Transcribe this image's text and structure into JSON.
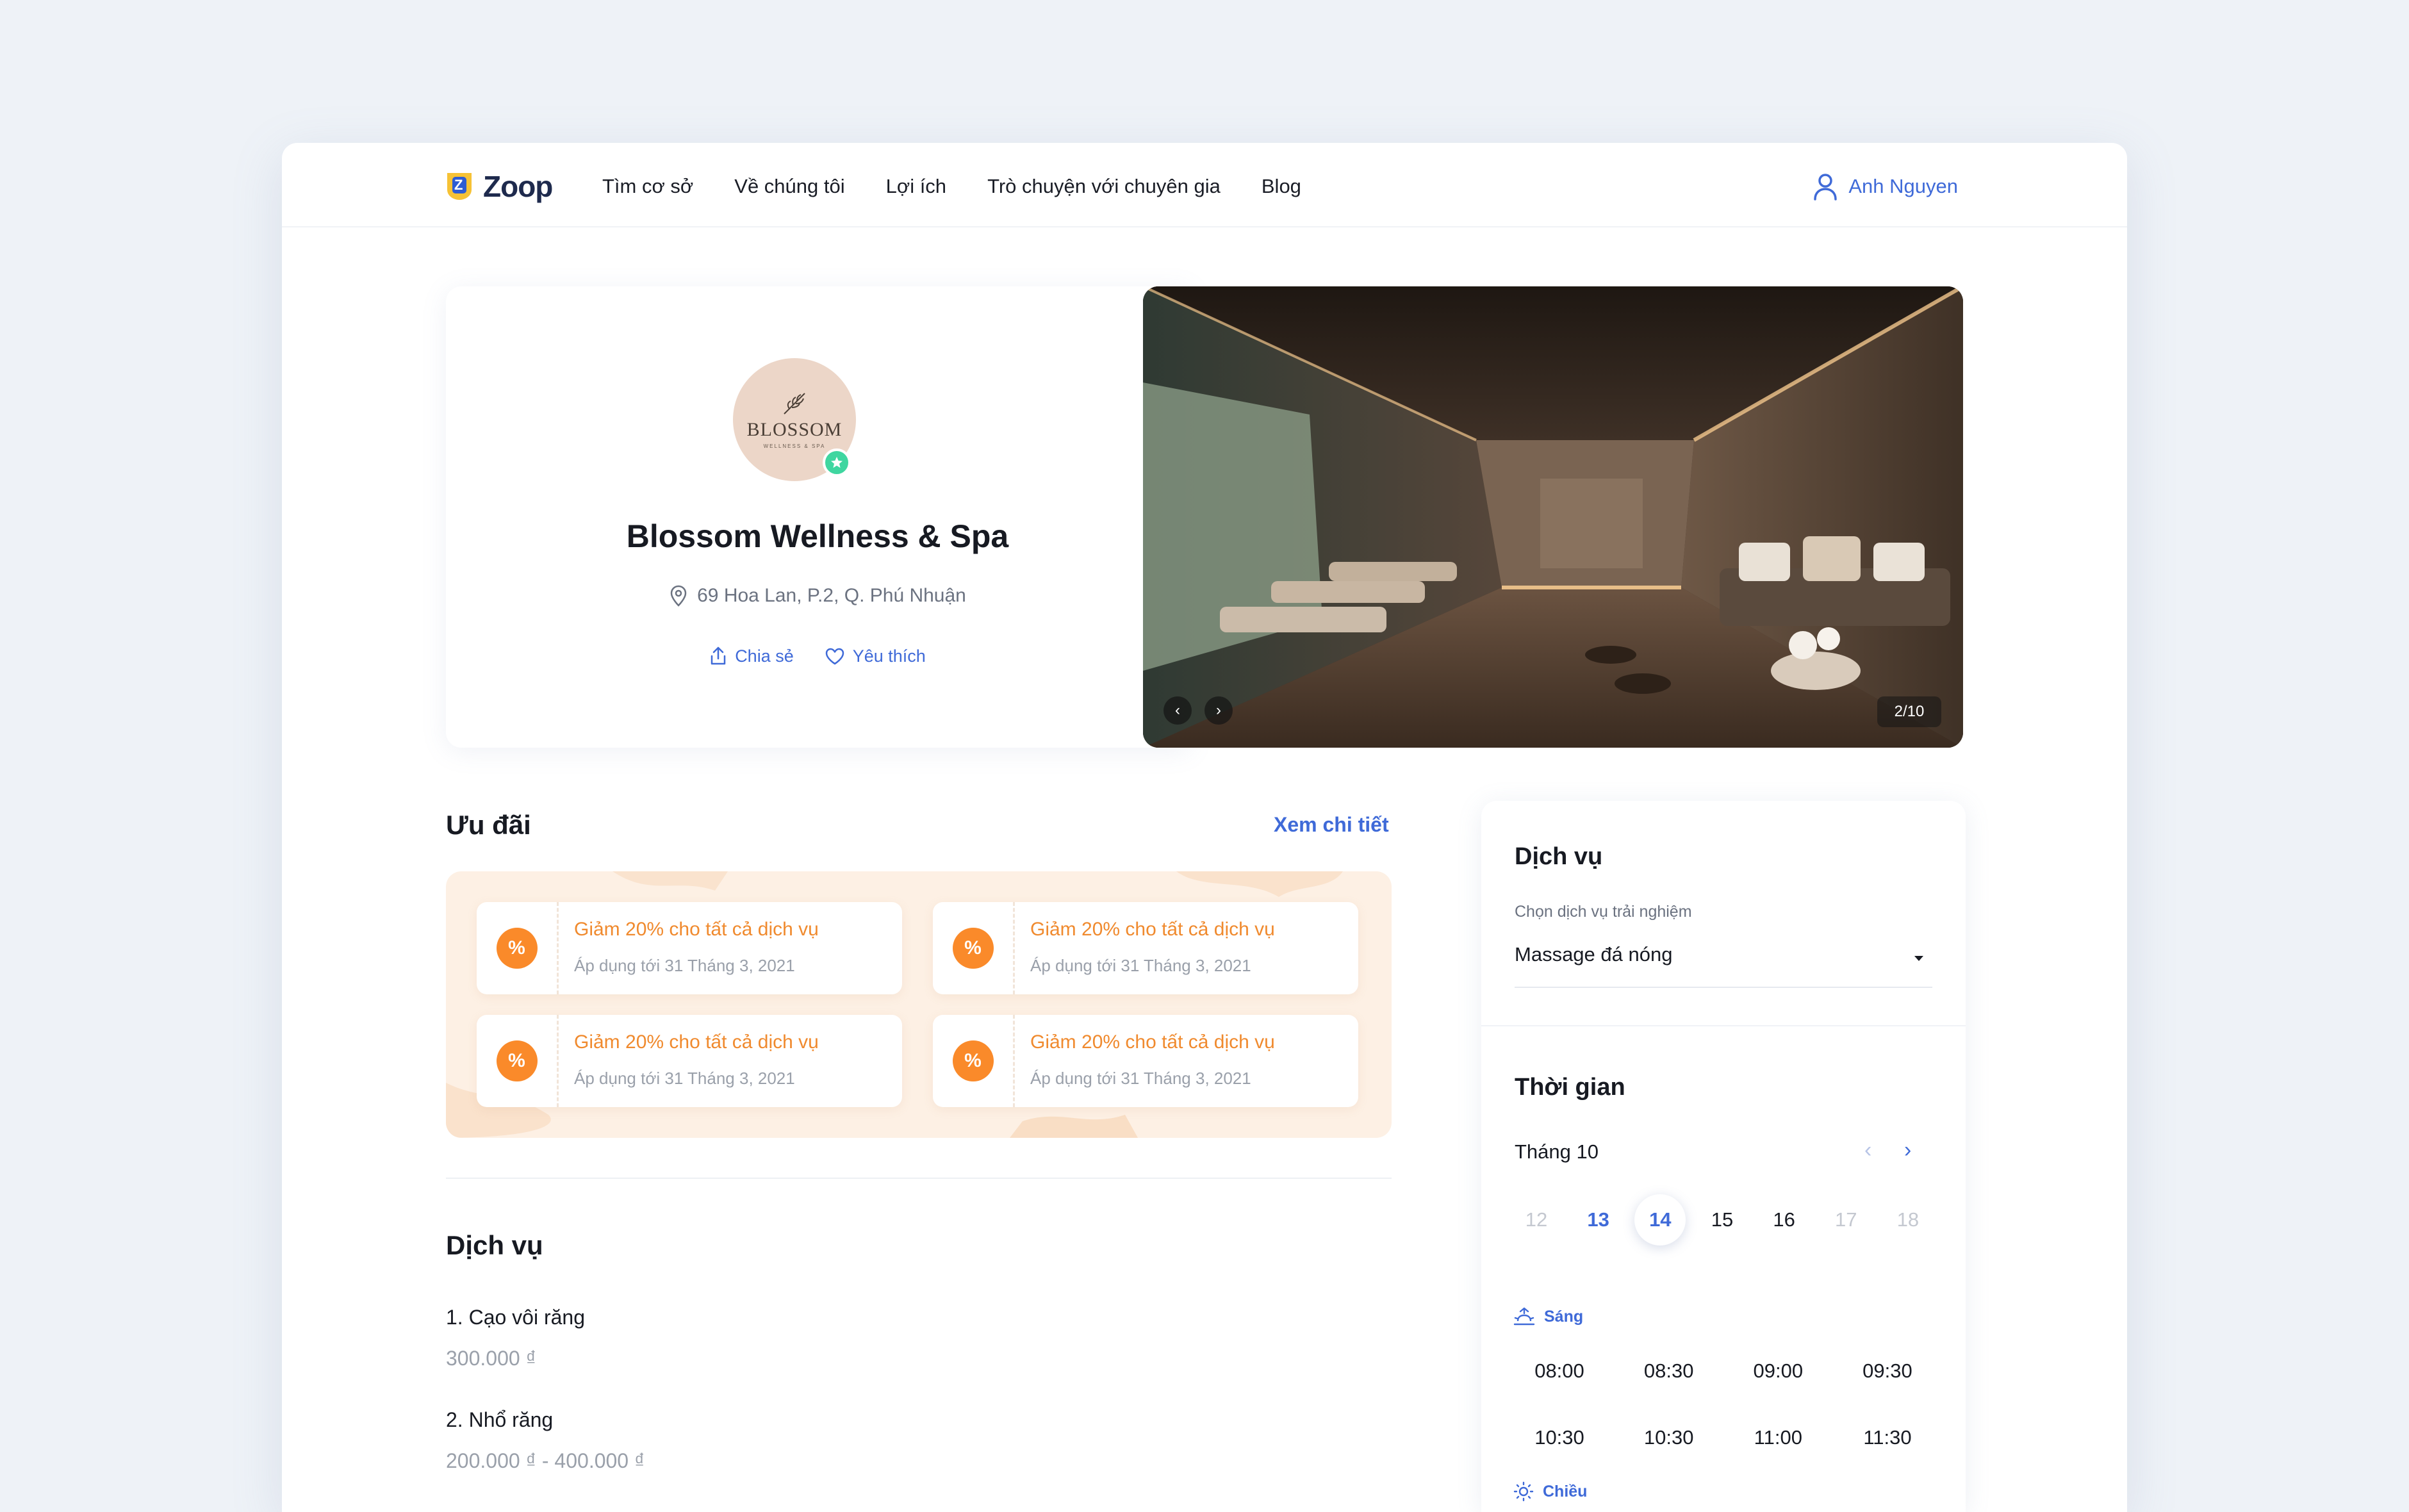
{
  "brand": {
    "name": "Zoop",
    "logo_letter": "Z",
    "accent": "#3f6ad8",
    "logo_yellow": "#f6c235"
  },
  "nav": {
    "items": [
      "Tìm cơ sở",
      "Về chúng tôi",
      "Lợi ích",
      "Trò chuyện với chuyên gia",
      "Blog"
    ]
  },
  "user": {
    "name": "Anh Nguyen",
    "icon": "user-icon"
  },
  "spa": {
    "logo_text": "BLOSSOM",
    "logo_sub": "WELLNESS & SPA",
    "name": "Blossom Wellness & Spa",
    "address": "69 Hoa Lan, P.2, Q. Phú Nhuận",
    "share_label": "Chia sẻ",
    "favorite_label": "Yêu thích"
  },
  "gallery": {
    "counter": "2/10",
    "prev": "‹",
    "next": "›"
  },
  "offers": {
    "title": "Ưu đãi",
    "more_label": "Xem chi tiết",
    "items": [
      {
        "icon": "%",
        "title": "Giảm 20% cho tất cả dịch vụ",
        "sub": "Áp dụng tới 31 Tháng 3, 2021"
      },
      {
        "icon": "%",
        "title": "Giảm 20% cho tất cả dịch vụ",
        "sub": "Áp dụng tới 31 Tháng 3, 2021"
      },
      {
        "icon": "%",
        "title": "Giảm 20% cho tất cả dịch vụ",
        "sub": "Áp dụng tới 31 Tháng 3, 2021"
      },
      {
        "icon": "%",
        "title": "Giảm 20% cho tất cả dịch vụ",
        "sub": "Áp dụng tới 31 Tháng 3, 2021"
      }
    ]
  },
  "services": {
    "title": "Dịch vụ",
    "items": [
      {
        "name": "1. Cạo vôi răng",
        "price": "300.000 ₫"
      },
      {
        "name": "2. Nhổ răng",
        "price": "200.000 ₫ - 400.000 ₫"
      }
    ]
  },
  "booking": {
    "service_title": "Dịch vụ",
    "service_label": "Chọn dịch vụ trải nghiệm",
    "service_value": "Massage đá nóng",
    "time_title": "Thời gian",
    "month": "Tháng 10",
    "prev_arrow": "‹",
    "next_arrow": "›",
    "days": [
      {
        "label": "12",
        "state": "disabled"
      },
      {
        "label": "13",
        "state": "accent"
      },
      {
        "label": "14",
        "state": "selected"
      },
      {
        "label": "15",
        "state": "avail"
      },
      {
        "label": "16",
        "state": "avail"
      },
      {
        "label": "17",
        "state": "disabled"
      },
      {
        "label": "18",
        "state": "disabled"
      }
    ],
    "morning_label": "Sáng",
    "afternoon_label": "Chiều",
    "morning_slots_row1": [
      "08:00",
      "08:30",
      "09:00",
      "09:30"
    ],
    "morning_slots_row2": [
      "10:30",
      "10:30",
      "11:00",
      "11:30"
    ]
  }
}
